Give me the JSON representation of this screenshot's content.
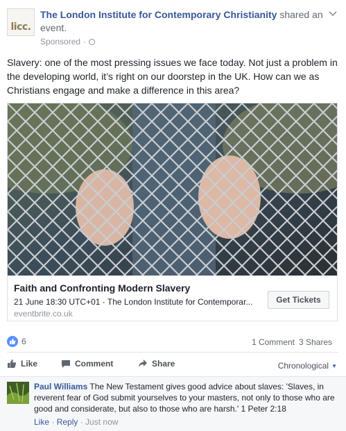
{
  "post": {
    "page_name": "The London Institute for Contemporary Christianity",
    "action": " shared an event.",
    "avatar_text": "licc.",
    "sponsored": "Sponsored",
    "dot": "·",
    "text": "Slavery: one of the most pressing issues we face today. Not just a problem in the developing world, it’s right on our doorstep in the UK. How can we as Christians engage and make a difference in this area?"
  },
  "link": {
    "title": "Faith and Confronting Modern Slavery",
    "meta": "21 June 18:30 UTC+01 · The London Institute for Contemporar...",
    "domain": "eventbrite.co.uk",
    "button": "Get Tickets"
  },
  "stats": {
    "likes": "6",
    "comments": "1 Comment",
    "shares": "3 Shares"
  },
  "actions": {
    "like": "Like",
    "comment": "Comment",
    "share": "Share",
    "order": "Chronological"
  },
  "comment": {
    "author": "Paul Williams",
    "text": " The New Testament gives good advice about slaves: 'Slaves, in reverent fear of God submit yourselves to your masters, not only to those who are good and considerate, but also to those who are harsh.' 1 Peter 2:18",
    "like": "Like",
    "reply": "Reply",
    "time": "Just now",
    "sep": " · "
  },
  "colors": {
    "link_blue": "#365899",
    "like_blue": "#5890ff"
  },
  "icons": {
    "globe": "globe-icon",
    "chevron": "chevron-down-icon",
    "like_badge": "thumbs-up-icon",
    "like_action": "thumbs-up-icon",
    "comment_action": "comment-bubble-icon",
    "share_action": "share-arrow-icon"
  }
}
